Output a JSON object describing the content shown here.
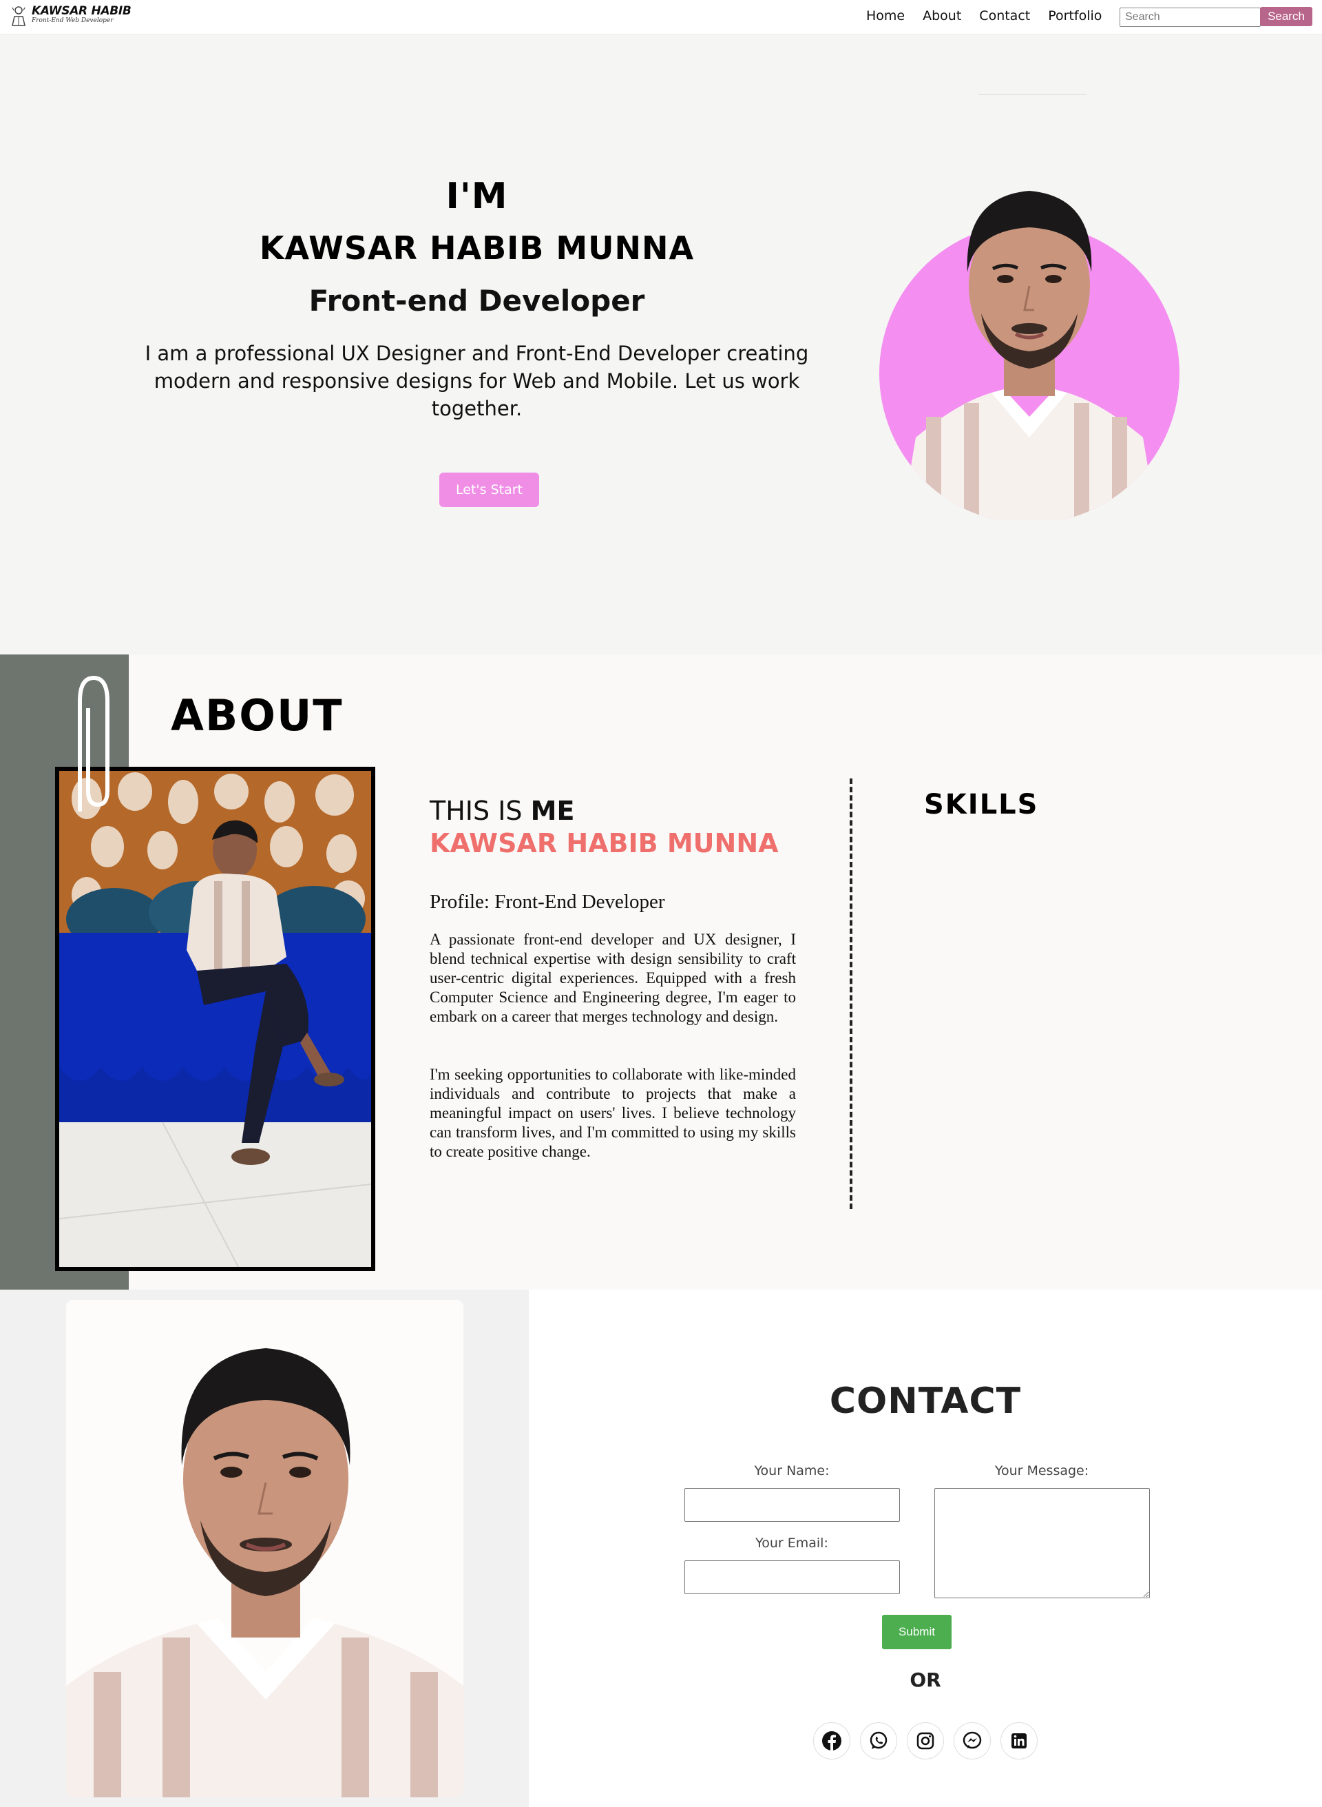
{
  "navbar": {
    "brand_name": "KAWSAR HABIB",
    "brand_tagline": "Front-End Web Developer",
    "links": [
      "Home",
      "About",
      "Contact",
      "Portfolio"
    ],
    "search_placeholder": "Search",
    "search_button": "Search"
  },
  "hero": {
    "greeting": "I'M",
    "name": "KAWSAR HABIB MUNNA",
    "role": "Front-end Developer",
    "description": "I am a professional UX Designer and Front-End Developer creating modern and responsive designs for Web and Mobile. Let us work together.",
    "cta_label": "Let's Start"
  },
  "about": {
    "title": "ABOUT",
    "this_is": "THIS IS",
    "me": "ME",
    "name": "KAWSAR HABIB MUNNA",
    "profile": "Profile: Front-End Developer",
    "paragraph1": "A passionate front-end developer and UX designer, I blend technical expertise with design sensibility to craft user-centric digital experiences. Equipped with a fresh Computer Science and Engineering degree, I'm eager to embark on a career that merges technology and design.",
    "paragraph2": "I'm seeking opportunities to collaborate with like-minded individuals and contribute to projects that make a meaningful impact on users' lives. I believe technology can transform lives, and I'm committed to using my skills to create positive change.",
    "skills_title": "SKILLS"
  },
  "contact": {
    "title": "CONTACT",
    "name_label": "Your Name:",
    "email_label": "Your Email:",
    "message_label": "Your Message:",
    "submit_label": "Submit",
    "or_label": "OR",
    "socials": [
      "facebook-icon",
      "whatsapp-icon",
      "instagram-icon",
      "messenger-icon",
      "linkedin-icon"
    ]
  },
  "colors": {
    "accent_pink": "#f08ee6",
    "search_button": "#b8658b",
    "name_coral": "#ef6f6c",
    "submit_green": "#4cae4f",
    "about_strip": "#6e756e"
  }
}
